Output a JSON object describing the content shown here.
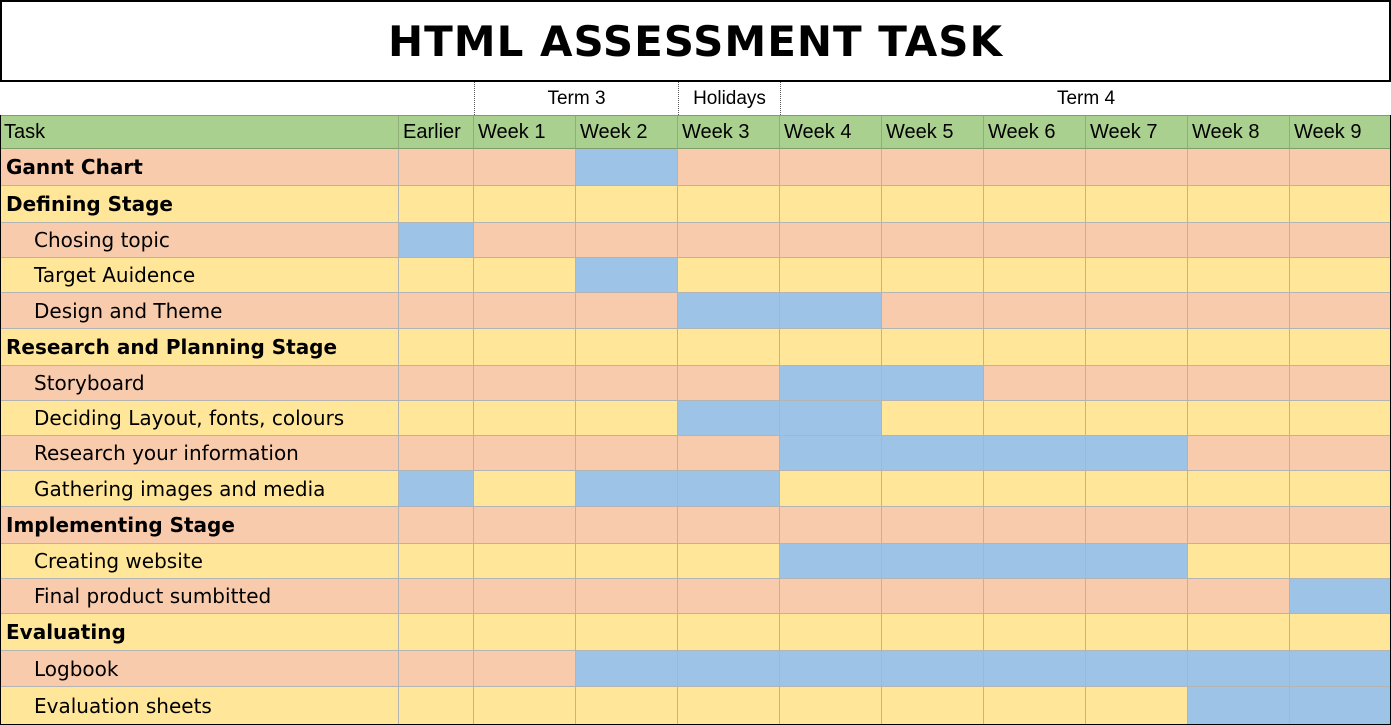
{
  "title": "HTML ASSESSMENT TASK",
  "terms": [
    {
      "label": "Term 3"
    },
    {
      "label": "Holidays"
    },
    {
      "label": "Term 4"
    }
  ],
  "header": {
    "task_label": "Task",
    "columns": [
      "Earlier",
      "Week 1",
      "Week 2",
      "Week 3",
      "Week 4",
      "Week 5",
      "Week 6",
      "Week 7",
      "Week 8",
      "Week 9"
    ]
  },
  "colors": {
    "row_odd": "#f8cbad",
    "row_even": "#ffe699",
    "scheduled": "#9dc3e6",
    "header": "#a9d08e"
  },
  "tasks": [
    {
      "label": "Gannt Chart",
      "level": "stage",
      "scheduled": [
        2
      ]
    },
    {
      "label": "Defining Stage",
      "level": "stage",
      "scheduled": []
    },
    {
      "label": "Chosing topic",
      "level": "sub",
      "scheduled": [
        0
      ]
    },
    {
      "label": "Target Auidence",
      "level": "sub",
      "scheduled": [
        2
      ]
    },
    {
      "label": "Design and Theme",
      "level": "sub",
      "scheduled": [
        3,
        4
      ]
    },
    {
      "label": "Research and Planning Stage",
      "level": "stage",
      "scheduled": []
    },
    {
      "label": "Storyboard",
      "level": "sub",
      "scheduled": [
        4,
        5
      ]
    },
    {
      "label": "Deciding Layout, fonts, colours",
      "level": "sub",
      "scheduled": [
        3,
        4
      ]
    },
    {
      "label": "Research your information",
      "level": "sub",
      "scheduled": [
        4,
        5,
        6,
        7
      ]
    },
    {
      "label": "Gathering images and media",
      "level": "sub",
      "scheduled": [
        0,
        2,
        3
      ]
    },
    {
      "label": "Implementing Stage",
      "level": "stage",
      "scheduled": []
    },
    {
      "label": "Creating website",
      "level": "sub",
      "scheduled": [
        4,
        5,
        6,
        7
      ]
    },
    {
      "label": "Final product sumbitted",
      "level": "sub",
      "scheduled": [
        9
      ]
    },
    {
      "label": "Evaluating",
      "level": "stage",
      "scheduled": []
    },
    {
      "label": "Logbook",
      "level": "sub",
      "scheduled": [
        2,
        3,
        4,
        5,
        6,
        7,
        8,
        9
      ]
    },
    {
      "label": "Evaluation sheets",
      "level": "sub",
      "scheduled": [
        8,
        9
      ]
    }
  ]
}
